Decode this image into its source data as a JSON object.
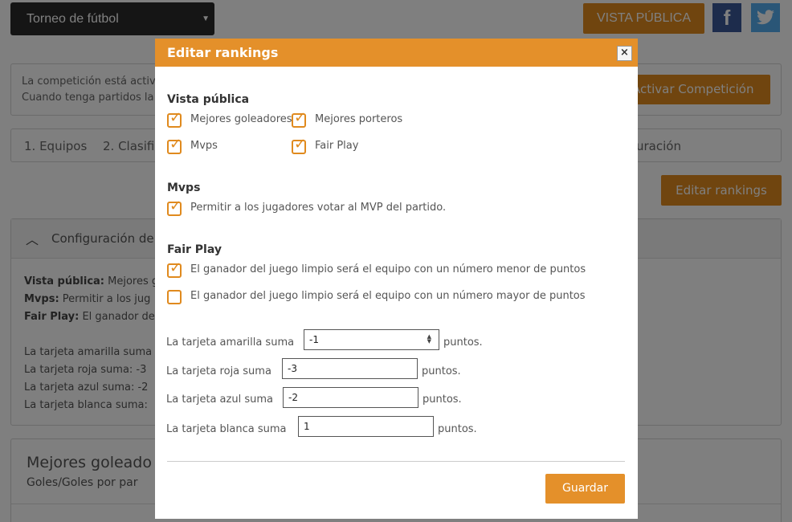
{
  "header": {
    "tournament": "Torneo de fútbol",
    "public_view_btn": "VISTA PÚBLICA",
    "facebook_glyph": "f"
  },
  "info": {
    "line1": "La competición está activa",
    "line2": "Cuando tenga partidos la c",
    "activate_btn": "Activar Competición"
  },
  "tabs": [
    "1. Equipos",
    "2. Clasifi",
    "uración"
  ],
  "edit_rankings_btn": "Editar rankings",
  "config": {
    "title": "Configuración de",
    "vista_label": "Vista pública:",
    "vista_value": " Mejores g",
    "mvps_label": "Mvps:",
    "mvps_value": " Permitir a los jug",
    "fair_label": "Fair Play:",
    "fair_value": " El ganador de",
    "amarilla": "La tarjeta amarilla suma",
    "roja": "La tarjeta roja suma: -3",
    "azul": "La tarjeta azul suma: -2",
    "blanca": "La tarjeta blanca suma:"
  },
  "scorers": {
    "title": "Mejores goleado",
    "subtitle": "Goles/Goles por par"
  },
  "modal": {
    "title": "Editar rankings",
    "close": "×",
    "vista_heading": "Vista pública",
    "vista_options": [
      {
        "label": "Mejores goleadores",
        "checked": true
      },
      {
        "label": "Mejores porteros",
        "checked": true
      },
      {
        "label": "Mvps",
        "checked": true
      },
      {
        "label": "Fair Play",
        "checked": true
      }
    ],
    "mvps_heading": "Mvps",
    "mvps_option": {
      "label": "Permitir a los jugadores votar al MVP del partido.",
      "checked": true
    },
    "fair_heading": "Fair Play",
    "fair_options": [
      {
        "label": "El ganador del juego limpio será el equipo con un número menor de puntos",
        "checked": true
      },
      {
        "label": "El ganador del juego limpio será el equipo con un número mayor de puntos",
        "checked": false
      }
    ],
    "cards": {
      "amarilla_label": "La tarjeta amarilla suma",
      "amarilla_value": "-1",
      "roja_label": "La tarjeta roja suma",
      "roja_value": "-3",
      "azul_label": "La tarjeta azul suma",
      "azul_value": "-2",
      "blanca_label": "La tarjeta blanca suma",
      "blanca_value": "1",
      "unit": "puntos."
    },
    "save_btn": "Guardar"
  }
}
